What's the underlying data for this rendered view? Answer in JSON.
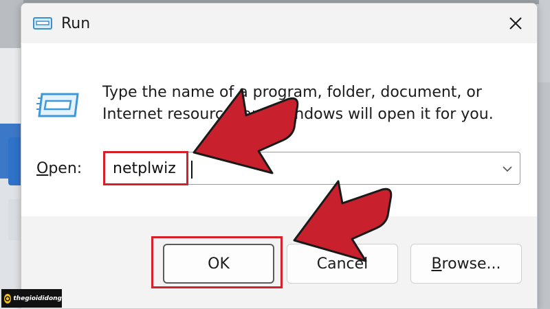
{
  "window": {
    "title": "Run",
    "close_glyph": "✕"
  },
  "dialog": {
    "description_line1": "Type the name of a program, folder, document, or",
    "description_line2": "Internet resource, and Windows will open it for you.",
    "open_label_accel": "O",
    "open_label_rest": "pen:",
    "input_value": "netplwiz"
  },
  "buttons": {
    "ok": "OK",
    "cancel": "Cancel",
    "browse_accel": "B",
    "browse_rest": "rowse..."
  },
  "watermark": {
    "brand": "thegioididong"
  },
  "colors": {
    "highlight": "#d4202a",
    "arrow_fill": "#c8202c",
    "arrow_stroke": "#1a1a1a",
    "icon_blue": "#4aa3df"
  },
  "icons": {
    "title": "run-window-icon",
    "body": "run-program-icon",
    "dropdown": "chevron-down-icon",
    "close": "close-icon"
  }
}
